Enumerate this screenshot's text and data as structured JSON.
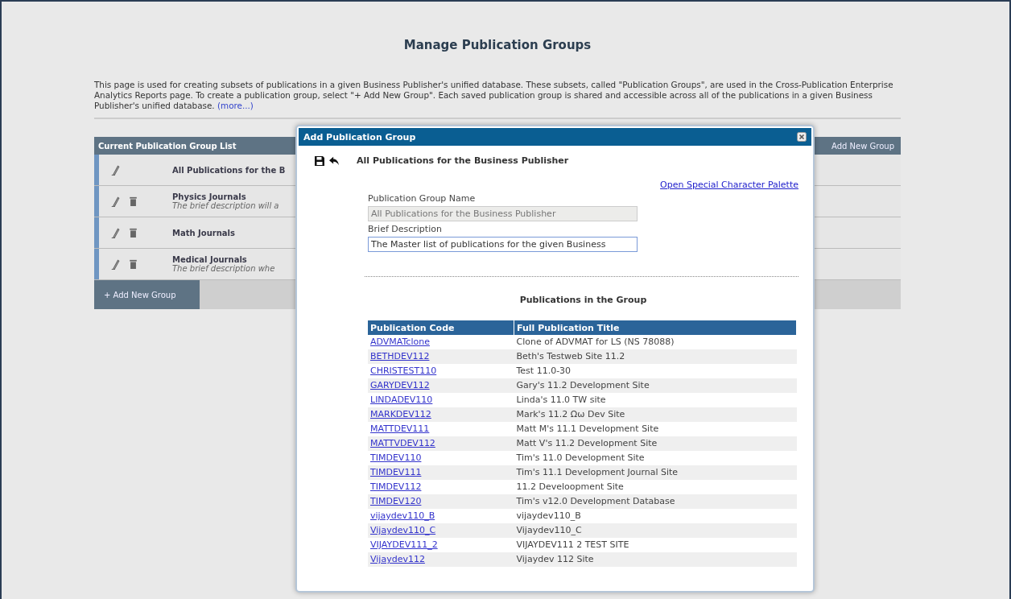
{
  "page": {
    "title": "Manage Publication Groups",
    "intro": "This page is used for creating subsets of publications in a given Business Publisher's unified database. These subsets, called \"Publication Groups\", are used in the Cross-Publication Enterprise Analytics Reports page. To create a publication group, select \"+ Add New Group\". Each saved publication group is shared and accessible across all of the publications in a given Business Publisher's unified database.",
    "more_link": "(more...)"
  },
  "group_list": {
    "header": "Current Publication Group List",
    "header_button": "Add New Group",
    "add_button": "+ Add New Group",
    "rows": [
      {
        "name": "All Publications for the B",
        "deletable": false
      },
      {
        "name": "Physics Journals",
        "description": "The brief description will a",
        "deletable": true
      },
      {
        "name": "Math Journals",
        "deletable": true
      },
      {
        "name": "Medical Journals",
        "description": "The brief description whe",
        "deletable": true
      }
    ]
  },
  "dialog": {
    "title": "Add Publication Group",
    "heading": "All Publications for the Business Publisher",
    "palette_link": "Open Special Character Palette",
    "name_label": "Publication Group Name",
    "name_value": "All Publications for the Business Publisher",
    "name_disabled": true,
    "description_label": "Brief Description",
    "description_value": "The Master list of publications for the given Business",
    "section_title": "Publications in the Group",
    "columns": [
      "Publication Code",
      "Full Publication Title"
    ],
    "rows": [
      {
        "code": "ADVMATclone",
        "title": "Clone of ADVMAT for LS (NS 78088)"
      },
      {
        "code": "BETHDEV112",
        "title": "Beth's Testweb Site 11.2"
      },
      {
        "code": "CHRISTEST110",
        "title": "Test 11.0-30"
      },
      {
        "code": "GARYDEV112",
        "title": "Gary's 11.2 Development Site"
      },
      {
        "code": "LINDADEV110",
        "title": "Linda's 11.0 TW site"
      },
      {
        "code": "MARKDEV112",
        "title": "Mark's 11.2 Ωω Dev Site"
      },
      {
        "code": "MATTDEV111",
        "title": "Matt M's 11.1 Development Site"
      },
      {
        "code": "MATTVDEV112",
        "title": "Matt V's 11.2 Development Site"
      },
      {
        "code": "TIMDEV110",
        "title": "Tim's 11.0 Development Site"
      },
      {
        "code": "TIMDEV111",
        "title": "Tim's 11.1 Development Journal Site"
      },
      {
        "code": "TIMDEV112",
        "title": "11.2 Develoopment Site"
      },
      {
        "code": "TIMDEV120",
        "title": "Tim's v12.0 Development Database"
      },
      {
        "code": "vijaydev110_B",
        "title": "vijaydev110_B"
      },
      {
        "code": "Vijaydev110_C",
        "title": "Vijaydev110_C"
      },
      {
        "code": "VIJAYDEV111_2",
        "title": "VIJAYDEV111 2 TEST SITE"
      },
      {
        "code": "Vijaydev112",
        "title": "Vijaydev 112 Site"
      }
    ]
  }
}
